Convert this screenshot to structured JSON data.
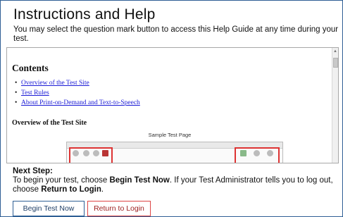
{
  "header": {
    "title": "Instructions and Help",
    "subtitle": "You may select the question mark button to access this Help Guide at any time during your test."
  },
  "contents": {
    "heading": "Contents",
    "items": [
      "Overview of the Test Site",
      "Test Rules",
      "About Print-on-Demand and Text-to-Speech"
    ]
  },
  "overview": {
    "heading": "Overview of the Test Site",
    "sample_label": "Sample Test Page"
  },
  "footer": {
    "next_heading": "Next Step:",
    "next_text_1": "To begin your test, choose ",
    "next_bold_1": "Begin Test Now",
    "next_text_2": ". If your Test Administrator tells you to log out, choose ",
    "next_bold_2": "Return to Login",
    "next_text_3": "."
  },
  "buttons": {
    "begin": "Begin Test Now",
    "return": "Return to Login"
  },
  "colors": {
    "border_blue": "#2f5f95",
    "link_blue": "#1b1bd6",
    "return_red": "#d44444"
  }
}
